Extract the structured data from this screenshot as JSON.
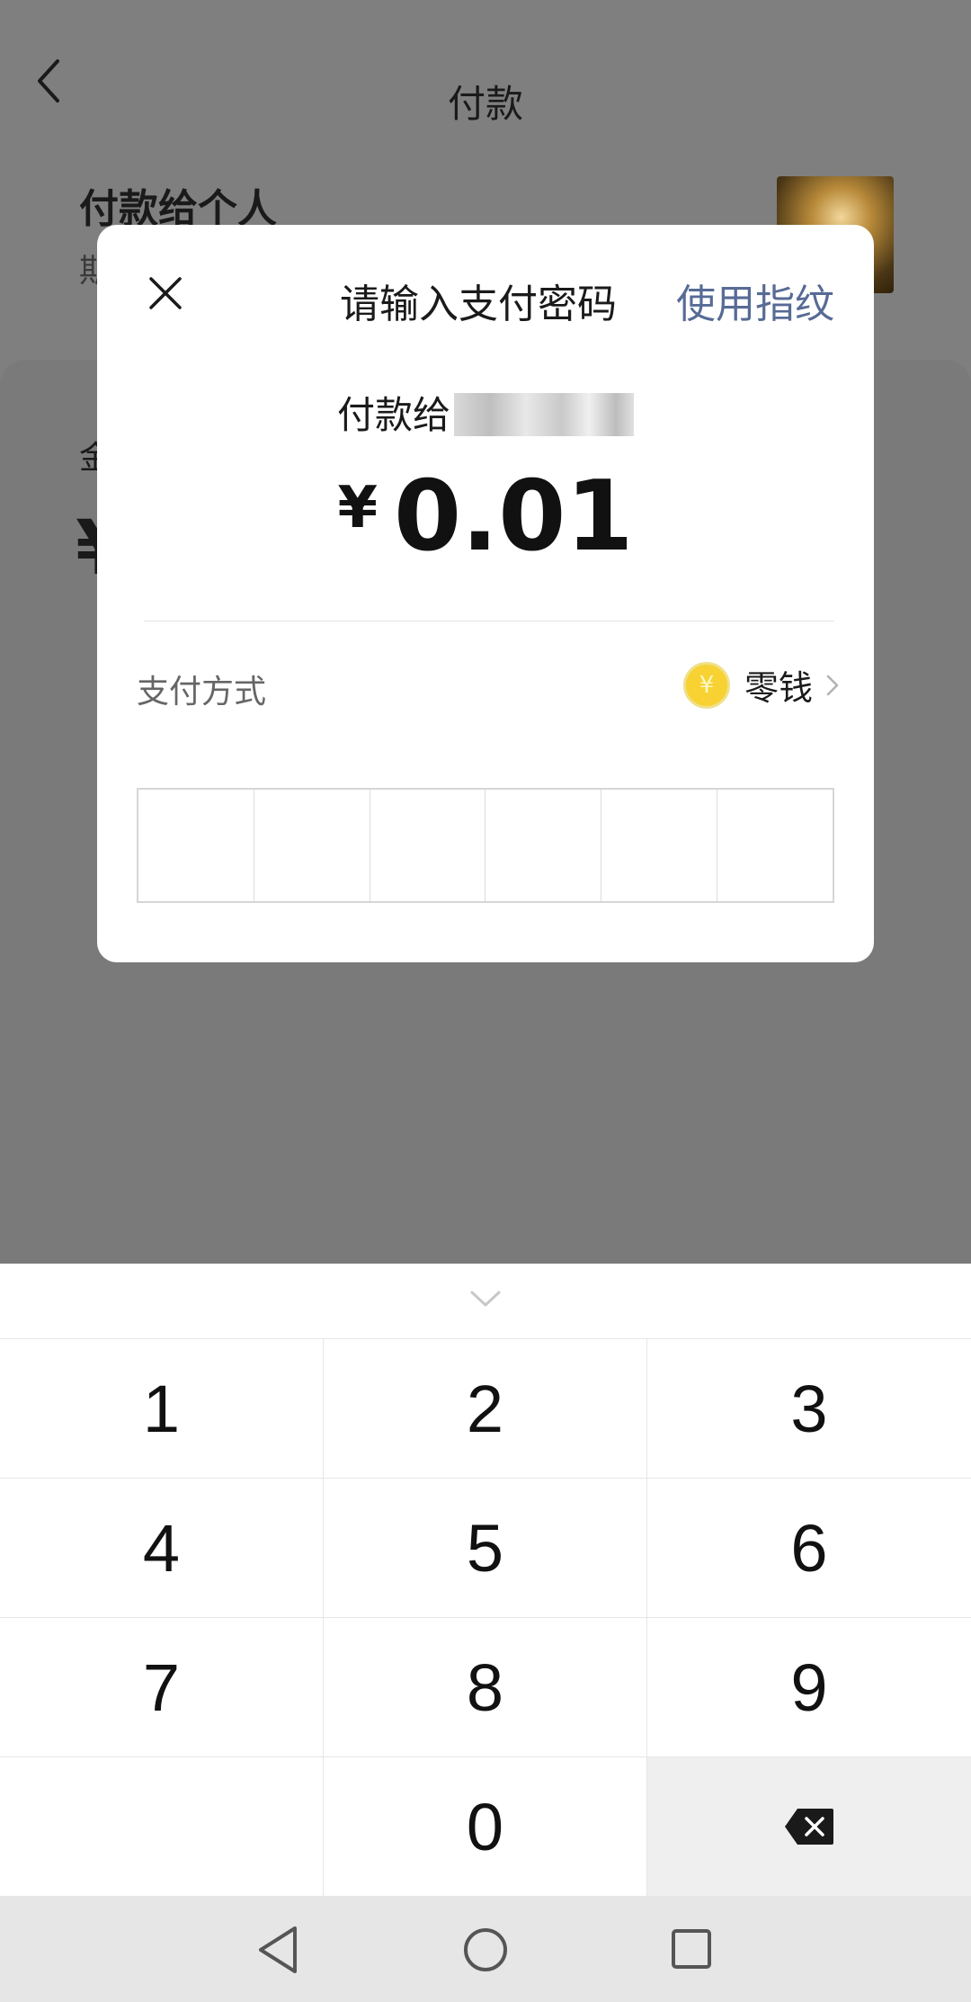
{
  "background": {
    "title": "付款",
    "payee_heading": "付款给个人",
    "payee_sub": "期",
    "amount_label": "金",
    "amount_symbol": "¥"
  },
  "dialog": {
    "title": "请输入支付密码",
    "fingerprint_link": "使用指纹",
    "payee_prefix": "付款给",
    "currency": "¥",
    "amount": "0.01",
    "method_label": "支付方式",
    "method_value": "零钱",
    "coin_glyph": "¥",
    "password_length": 6,
    "accent_color": "#576b95"
  },
  "keypad": {
    "keys": [
      "1",
      "2",
      "3",
      "4",
      "5",
      "6",
      "7",
      "8",
      "9",
      "",
      "0",
      "delete"
    ]
  },
  "icons": {
    "close": "close-icon",
    "chevron": "chevron-right-icon",
    "collapse": "chevron-down-icon",
    "delete": "backspace-icon"
  }
}
